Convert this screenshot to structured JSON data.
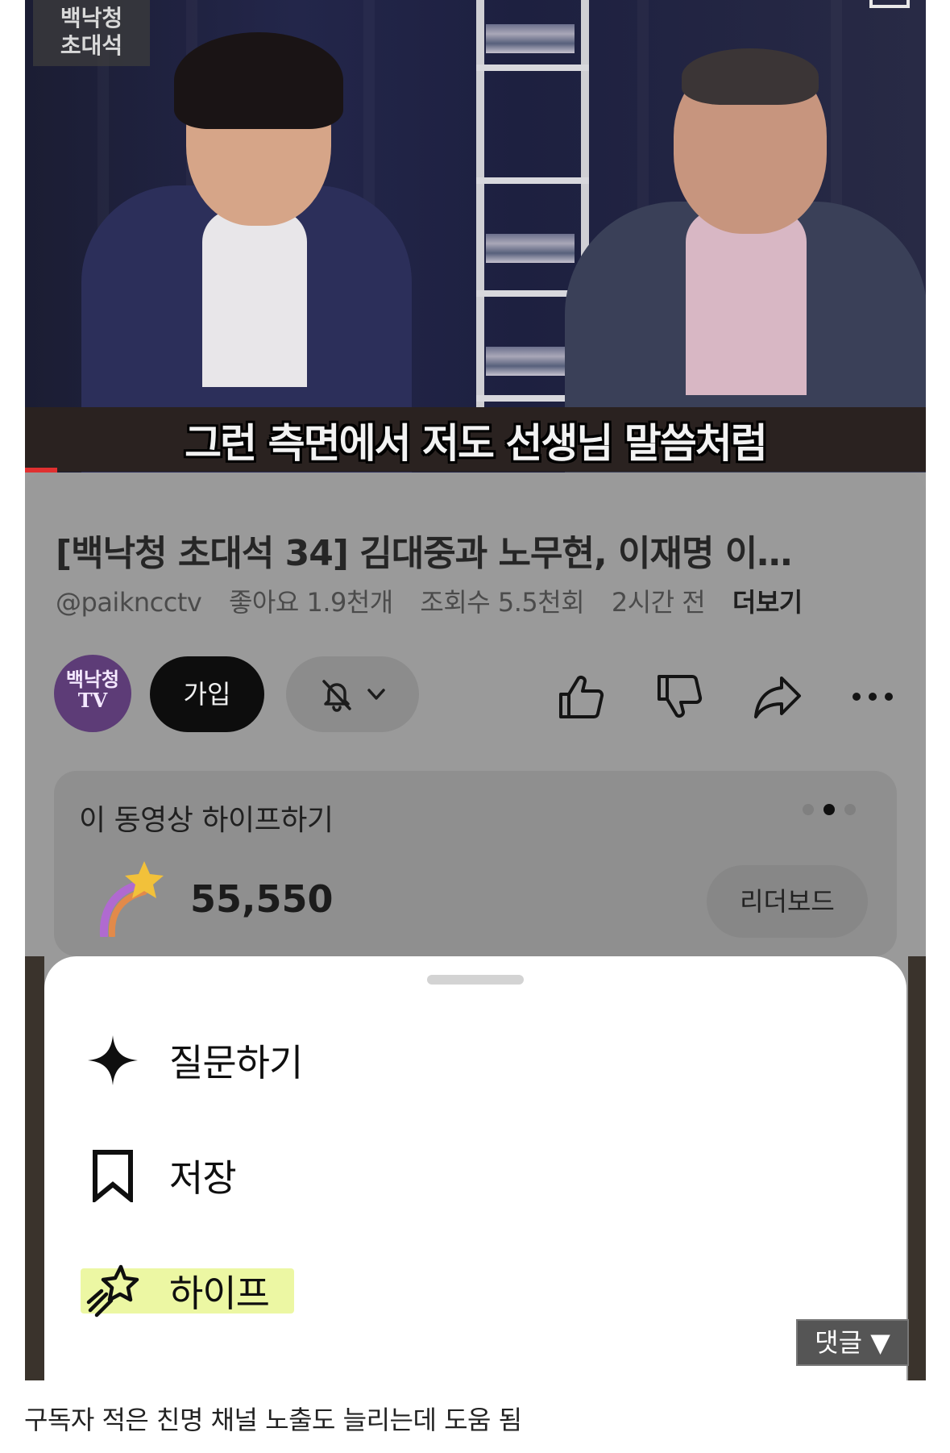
{
  "video": {
    "watermark": "백낙청\n초대석",
    "subtitle": "그런 측면에서 저도 선생님 말씀처럼"
  },
  "info": {
    "title": "[백낙청 초대석 34] 김대중과 노무현, 이재명 이…",
    "channel_handle": "@paikncctv",
    "likes": "좋아요 1.9천개",
    "views": "조회수 5.5천회",
    "time_ago": "2시간 전",
    "more_label": "더보기"
  },
  "channel": {
    "avatar_text": "백낙청\nTV",
    "join_label": "가입"
  },
  "hype": {
    "title": "이 동영상 하이프하기",
    "count": "55,550",
    "leaderboard_label": "리더보드",
    "page_dots": 3,
    "active_dot": 2
  },
  "sheet": {
    "items": [
      {
        "label": "질문하기",
        "icon": "sparkle-icon"
      },
      {
        "label": "저장",
        "icon": "bookmark-icon"
      },
      {
        "label": "하이프",
        "icon": "hype-star-icon",
        "highlighted": true
      }
    ]
  },
  "overlay": {
    "comment_label": "댓글 ▼"
  },
  "caption": "구독자 적은 친명 채널 노출도 늘리는데 도움 됨",
  "colors": {
    "highlight": "#ecf7a3",
    "progress": "#e03030",
    "avatar_bg": "#5d3c77"
  }
}
